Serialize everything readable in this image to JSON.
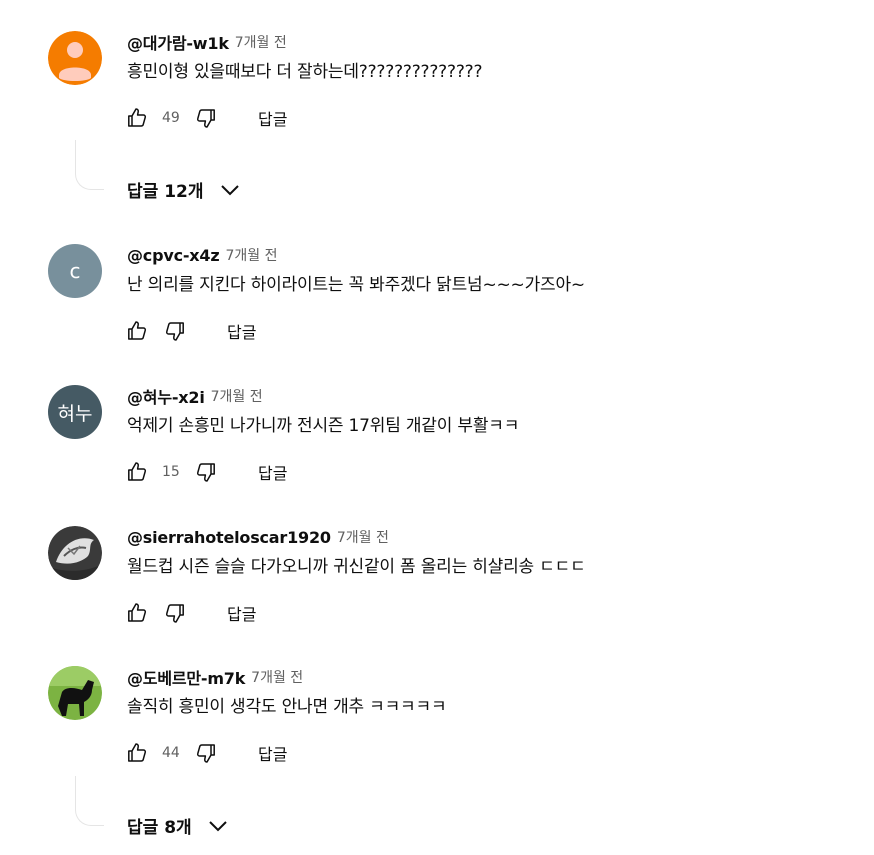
{
  "comments": [
    {
      "author": "@대가람-w1k",
      "time": "7개월 전",
      "text": "흥민이형 있을때보다 더 잘하는데??????????????",
      "likes": "49",
      "reply_label": "답글",
      "replies_label": "답글 12개",
      "avatar_color": "#f57c00"
    },
    {
      "author": "@cpvc-x4z",
      "time": "7개월 전",
      "text": "난 의리를 지킨다 하이라이트는 꼭 봐주겠다 닭트넘~~~가즈아~",
      "likes": "",
      "reply_label": "답글",
      "avatar_letter": "c",
      "avatar_color": "#78909c"
    },
    {
      "author": "@혀누-x2i",
      "time": "7개월 전",
      "text": "억제기 손흥민 나가니까 전시즌 17위팀 개같이 부활ㅋㅋ",
      "likes": "15",
      "reply_label": "답글",
      "avatar_letter": "혀누",
      "avatar_color": "#455a64"
    },
    {
      "author": "@sierrahoteloscar1920",
      "time": "7개월 전",
      "text": "월드컵 시즌 슬슬 다가오니까 귀신같이 폼 올리는 히샬리송 ㄷㄷㄷ",
      "likes": "",
      "reply_label": "답글"
    },
    {
      "author": "@도베르만-m7k",
      "time": "7개월 전",
      "text": "솔직히 흥민이 생각도 안나면 개추 ㅋㅋㅋㅋㅋ",
      "likes": "44",
      "reply_label": "답글",
      "replies_label": "답글 8개"
    }
  ]
}
